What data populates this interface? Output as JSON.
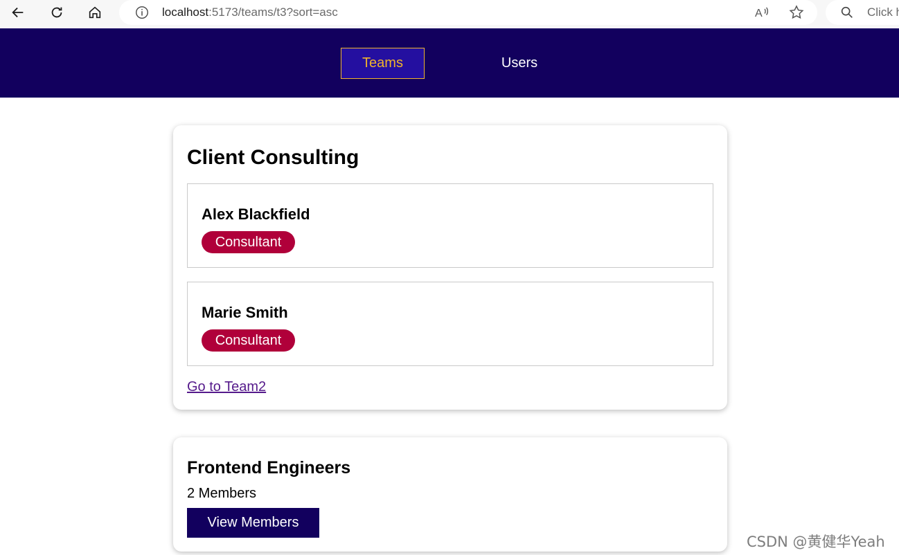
{
  "browser": {
    "url_host": "localhost",
    "url_path": ":5173/teams/t3?sort=asc",
    "search_placeholder": "Click h",
    "icons": [
      "back-icon",
      "refresh-icon",
      "home-icon",
      "info-icon",
      "read-aloud-icon",
      "favorite-star-icon",
      "search-icon"
    ]
  },
  "header": {
    "tabs": [
      {
        "label": "Teams",
        "active": true
      },
      {
        "label": "Users",
        "active": false
      }
    ],
    "bg_color": "#12005e",
    "active_color": "#f0b42c"
  },
  "team_detail": {
    "title": "Client Consulting",
    "members": [
      {
        "name": "Alex Blackfield",
        "role": "Consultant"
      },
      {
        "name": "Marie Smith",
        "role": "Consultant"
      }
    ],
    "link_label": "Go to Team2",
    "badge_color": "#b0003a"
  },
  "team_summary": {
    "title": "Frontend Engineers",
    "member_count": "2 Members",
    "button_label": "View Members"
  },
  "watermark": "CSDN @黄健华Yeah"
}
